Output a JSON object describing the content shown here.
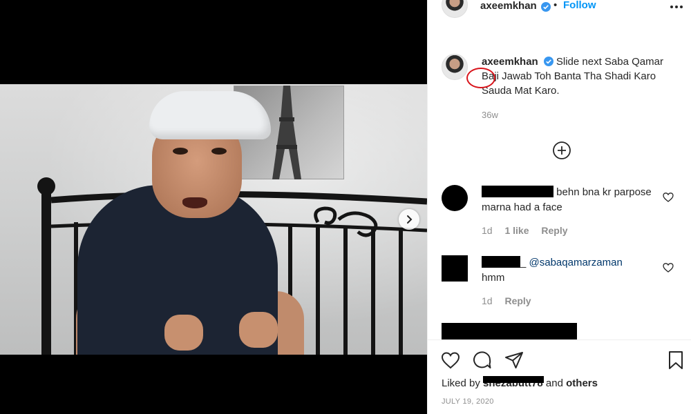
{
  "post": {
    "author": "axeemkhan",
    "follow_separator": "•",
    "follow_label": "Follow",
    "more_icon": "more-horizontal-icon",
    "verified_icon": "verified-badge-icon"
  },
  "media": {
    "next_icon": "chevron-right-icon"
  },
  "caption": {
    "author": "axeemkhan",
    "text": "Slide next Saba Qamar Baji Jawab Toh Banta Tha Shadi Karo Sauda Mat Karo.",
    "age": "36w",
    "annotation_color": "#d8131a"
  },
  "load_more_icon": "plus-circle-icon",
  "comments": [
    {
      "text": "behn bna kr parpose marna had a face",
      "time": "1d",
      "likes": "1 like",
      "reply": "Reply"
    },
    {
      "mention": "@sabaqamarzaman",
      "suffix": "_",
      "text": "hmm",
      "time": "1d",
      "reply": "Reply"
    }
  ],
  "actions": {
    "like_icon": "heart-icon",
    "comment_icon": "comment-icon",
    "share_icon": "paper-plane-icon",
    "save_icon": "bookmark-icon",
    "liked_by_prefix": "Liked by",
    "liked_by_user": "shezabutt78",
    "liked_by_conj": "and",
    "liked_by_others": "others",
    "date": "JULY 19, 2020"
  },
  "colors": {
    "link_blue": "#0095f6",
    "mention_blue": "#00376b",
    "muted": "#8e8e8e"
  }
}
